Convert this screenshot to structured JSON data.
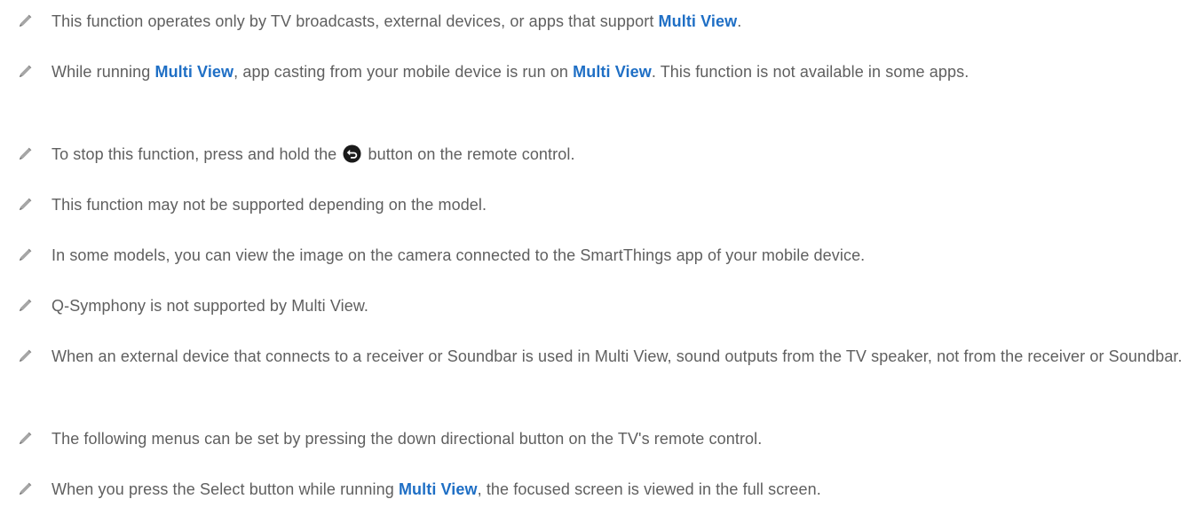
{
  "icons": {
    "note": "pencil-icon",
    "back": "back-button-icon"
  },
  "colors": {
    "text": "#5f5f5f",
    "link": "#1f6fc5",
    "icon": "#9a9a9a"
  },
  "notes": [
    {
      "parts": [
        "This function operates only by TV broadcasts, external devices, or apps that support ",
        "Multi View",
        "."
      ]
    },
    {
      "parts": [
        "While running ",
        "Multi View",
        ", app casting from your mobile device is run on ",
        "Multi View",
        ". This function is not available in some apps."
      ]
    },
    {
      "parts": [
        "To stop this function, press and hold the ",
        " button on the remote control."
      ]
    },
    {
      "text": "This function may not be supported depending on the model."
    },
    {
      "text": "In some models, you can view the image on the camera connected to the SmartThings app of your mobile device."
    },
    {
      "text": "Q-Symphony is not supported by Multi View."
    },
    {
      "text": "When an external device that connects to a receiver or Soundbar is used in Multi View, sound outputs from the TV speaker, not from the receiver or Soundbar."
    },
    {
      "text": "The following menus can be set by pressing the down directional button on the TV's remote control."
    },
    {
      "parts": [
        "When you press the Select button while running ",
        "Multi View",
        ", the focused screen is viewed in the full screen."
      ]
    }
  ]
}
